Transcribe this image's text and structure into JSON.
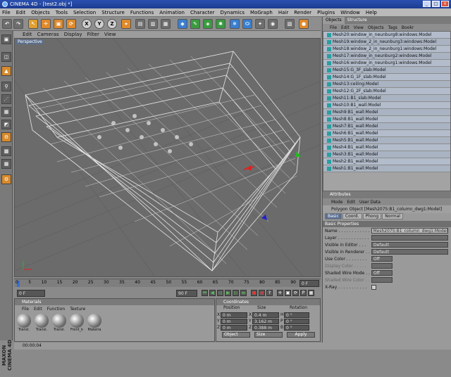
{
  "window": {
    "title": "CINEMA 4D - [test2.obj *]"
  },
  "menubar": [
    "File",
    "Edit",
    "Objects",
    "Tools",
    "Selection",
    "Structure",
    "Functions",
    "Animation",
    "Character",
    "Dynamics",
    "MoGraph",
    "Hair",
    "Render",
    "Plugins",
    "Window",
    "Help"
  ],
  "toolbar": {
    "x_label": "X",
    "y_label": "Y",
    "z_label": "Z"
  },
  "viewport": {
    "menu": [
      "Edit",
      "Cameras",
      "Display",
      "Filter",
      "View"
    ],
    "label": "Perspective"
  },
  "timeline": {
    "ticks": [
      "0",
      "5",
      "10",
      "15",
      "20",
      "25",
      "30",
      "35",
      "40",
      "45",
      "50",
      "55",
      "60",
      "65",
      "70",
      "75",
      "80",
      "85",
      "90"
    ],
    "end_field": "0 F",
    "start_field": "0 F",
    "max_field": "90 F"
  },
  "materials": {
    "header": "Materials",
    "menu": [
      "File",
      "Edit",
      "Function",
      "Texture"
    ],
    "items": [
      "Transl.",
      "Transl.",
      "Transl.",
      "Front_k",
      "Materia"
    ]
  },
  "coordinates": {
    "header": "Coordinates",
    "col_position": "Position",
    "col_size": "Size",
    "col_rotation": "Rotation",
    "rows": [
      {
        "axis": "X",
        "pos": "0 m",
        "size_axis": "X",
        "size": "0.4 m",
        "rot_axis": "H",
        "rot": "0 °"
      },
      {
        "axis": "Y",
        "pos": "0 m",
        "size_axis": "Y",
        "size": "3.162 m",
        "rot_axis": "P",
        "rot": "0 °"
      },
      {
        "axis": "Z",
        "pos": "0 m",
        "size_axis": "Z",
        "size": "0.388 m",
        "rot_axis": "B",
        "rot": "0 °"
      }
    ],
    "object_dropdown": "Object",
    "size_dropdown": "Size",
    "apply_label": "Apply"
  },
  "status": {
    "time": "00:00:04"
  },
  "objects_panel": {
    "tabs": [
      "Objects",
      "Structure"
    ],
    "menu": [
      "File",
      "Edit",
      "View",
      "Objects",
      "Tags",
      "Bookr"
    ],
    "items": [
      "Mesh20:window_in_neunburg8:windows:Model",
      "Mesh19:window_2_in_neunburg3:windows:Model",
      "Mesh18:window_2_in_neunburg1:windows:Model",
      "Mesh17:window_in_neunburg2:windows:Model",
      "Mesh16:window_in_neunburg1:windows:Model",
      "Mesh15:G_3F_slab:Model",
      "Mesh14:G_1F_slab:Model",
      "Mesh13:ceiling:Model",
      "Mesh12:G_2F_slab:Model",
      "Mesh11:B1_slab:Model",
      "Mesh10:B1_wall:Model",
      "Mesh9:B1_wall:Model",
      "Mesh8:B1_wall:Model",
      "Mesh7:B1_wall:Model",
      "Mesh6:B1_wall:Model",
      "Mesh5:B1_wall:Model",
      "Mesh4:B1_wall:Model",
      "Mesh3:B1_wall:Model",
      "Mesh2:B1_wall:Model",
      "Mesh1:B1_wall:Model"
    ]
  },
  "attributes_panel": {
    "header": "Attributes",
    "menu": [
      "Mode",
      "Edit",
      "User Data"
    ],
    "object_line": "Polygon Object [Mesh2075:B1_column_dwg1:Model]",
    "tabs": [
      "Basic",
      "Coord.",
      "Phong",
      "Normal"
    ],
    "section": "Basic Properties",
    "props": [
      {
        "label": "Name . . . . . . . . . . . .",
        "value": "Mesh2075:B1_column_dwg1:Model"
      },
      {
        "label": "Layer . . . . . . . . . . . .",
        "value": ""
      },
      {
        "label": "Visible in Editor . . .",
        "value": "Default"
      },
      {
        "label": "Visible in Renderer . .",
        "value": "Default"
      },
      {
        "label": "Use Color . . . . . . . .",
        "value": "Off"
      },
      {
        "label": "Display Color . . . . .",
        "value": ""
      },
      {
        "label": "Shaded Wire Mode . .",
        "value": "Off"
      },
      {
        "label": "Shaded Wire Color . .",
        "value": ""
      },
      {
        "label": "X-Ray . . . . . . . . . . .",
        "value": ""
      }
    ]
  }
}
